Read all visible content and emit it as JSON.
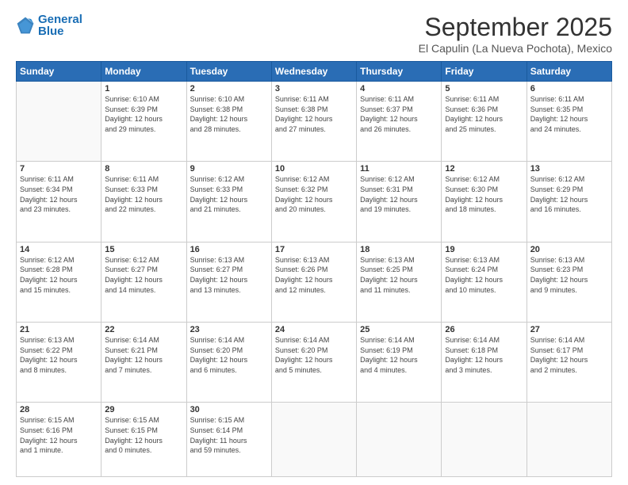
{
  "logo": {
    "line1": "General",
    "line2": "Blue"
  },
  "title": "September 2025",
  "location": "El Capulin (La Nueva Pochota), Mexico",
  "days_header": [
    "Sunday",
    "Monday",
    "Tuesday",
    "Wednesday",
    "Thursday",
    "Friday",
    "Saturday"
  ],
  "weeks": [
    [
      {
        "num": "",
        "info": ""
      },
      {
        "num": "1",
        "info": "Sunrise: 6:10 AM\nSunset: 6:39 PM\nDaylight: 12 hours\nand 29 minutes."
      },
      {
        "num": "2",
        "info": "Sunrise: 6:10 AM\nSunset: 6:38 PM\nDaylight: 12 hours\nand 28 minutes."
      },
      {
        "num": "3",
        "info": "Sunrise: 6:11 AM\nSunset: 6:38 PM\nDaylight: 12 hours\nand 27 minutes."
      },
      {
        "num": "4",
        "info": "Sunrise: 6:11 AM\nSunset: 6:37 PM\nDaylight: 12 hours\nand 26 minutes."
      },
      {
        "num": "5",
        "info": "Sunrise: 6:11 AM\nSunset: 6:36 PM\nDaylight: 12 hours\nand 25 minutes."
      },
      {
        "num": "6",
        "info": "Sunrise: 6:11 AM\nSunset: 6:35 PM\nDaylight: 12 hours\nand 24 minutes."
      }
    ],
    [
      {
        "num": "7",
        "info": "Sunrise: 6:11 AM\nSunset: 6:34 PM\nDaylight: 12 hours\nand 23 minutes."
      },
      {
        "num": "8",
        "info": "Sunrise: 6:11 AM\nSunset: 6:33 PM\nDaylight: 12 hours\nand 22 minutes."
      },
      {
        "num": "9",
        "info": "Sunrise: 6:12 AM\nSunset: 6:33 PM\nDaylight: 12 hours\nand 21 minutes."
      },
      {
        "num": "10",
        "info": "Sunrise: 6:12 AM\nSunset: 6:32 PM\nDaylight: 12 hours\nand 20 minutes."
      },
      {
        "num": "11",
        "info": "Sunrise: 6:12 AM\nSunset: 6:31 PM\nDaylight: 12 hours\nand 19 minutes."
      },
      {
        "num": "12",
        "info": "Sunrise: 6:12 AM\nSunset: 6:30 PM\nDaylight: 12 hours\nand 18 minutes."
      },
      {
        "num": "13",
        "info": "Sunrise: 6:12 AM\nSunset: 6:29 PM\nDaylight: 12 hours\nand 16 minutes."
      }
    ],
    [
      {
        "num": "14",
        "info": "Sunrise: 6:12 AM\nSunset: 6:28 PM\nDaylight: 12 hours\nand 15 minutes."
      },
      {
        "num": "15",
        "info": "Sunrise: 6:12 AM\nSunset: 6:27 PM\nDaylight: 12 hours\nand 14 minutes."
      },
      {
        "num": "16",
        "info": "Sunrise: 6:13 AM\nSunset: 6:27 PM\nDaylight: 12 hours\nand 13 minutes."
      },
      {
        "num": "17",
        "info": "Sunrise: 6:13 AM\nSunset: 6:26 PM\nDaylight: 12 hours\nand 12 minutes."
      },
      {
        "num": "18",
        "info": "Sunrise: 6:13 AM\nSunset: 6:25 PM\nDaylight: 12 hours\nand 11 minutes."
      },
      {
        "num": "19",
        "info": "Sunrise: 6:13 AM\nSunset: 6:24 PM\nDaylight: 12 hours\nand 10 minutes."
      },
      {
        "num": "20",
        "info": "Sunrise: 6:13 AM\nSunset: 6:23 PM\nDaylight: 12 hours\nand 9 minutes."
      }
    ],
    [
      {
        "num": "21",
        "info": "Sunrise: 6:13 AM\nSunset: 6:22 PM\nDaylight: 12 hours\nand 8 minutes."
      },
      {
        "num": "22",
        "info": "Sunrise: 6:14 AM\nSunset: 6:21 PM\nDaylight: 12 hours\nand 7 minutes."
      },
      {
        "num": "23",
        "info": "Sunrise: 6:14 AM\nSunset: 6:20 PM\nDaylight: 12 hours\nand 6 minutes."
      },
      {
        "num": "24",
        "info": "Sunrise: 6:14 AM\nSunset: 6:20 PM\nDaylight: 12 hours\nand 5 minutes."
      },
      {
        "num": "25",
        "info": "Sunrise: 6:14 AM\nSunset: 6:19 PM\nDaylight: 12 hours\nand 4 minutes."
      },
      {
        "num": "26",
        "info": "Sunrise: 6:14 AM\nSunset: 6:18 PM\nDaylight: 12 hours\nand 3 minutes."
      },
      {
        "num": "27",
        "info": "Sunrise: 6:14 AM\nSunset: 6:17 PM\nDaylight: 12 hours\nand 2 minutes."
      }
    ],
    [
      {
        "num": "28",
        "info": "Sunrise: 6:15 AM\nSunset: 6:16 PM\nDaylight: 12 hours\nand 1 minute."
      },
      {
        "num": "29",
        "info": "Sunrise: 6:15 AM\nSunset: 6:15 PM\nDaylight: 12 hours\nand 0 minutes."
      },
      {
        "num": "30",
        "info": "Sunrise: 6:15 AM\nSunset: 6:14 PM\nDaylight: 11 hours\nand 59 minutes."
      },
      {
        "num": "",
        "info": ""
      },
      {
        "num": "",
        "info": ""
      },
      {
        "num": "",
        "info": ""
      },
      {
        "num": "",
        "info": ""
      }
    ]
  ]
}
